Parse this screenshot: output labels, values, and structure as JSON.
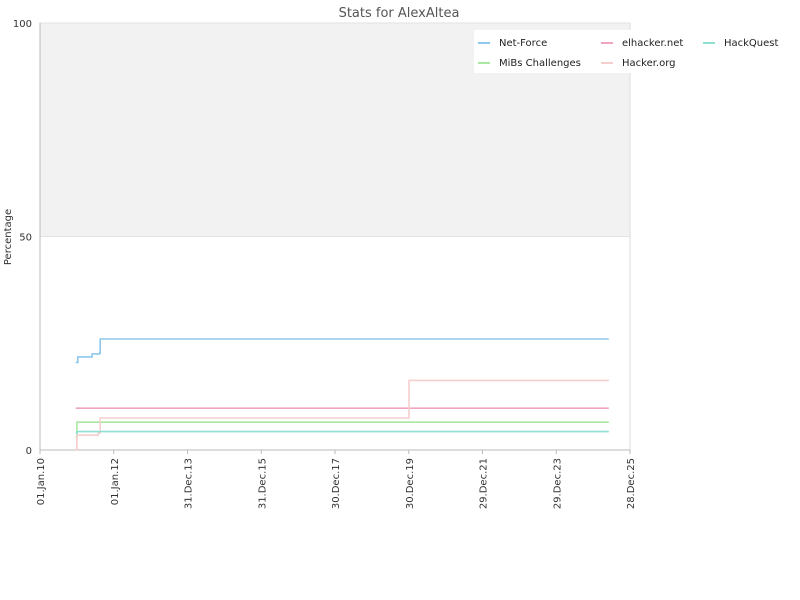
{
  "chart_data": {
    "type": "line",
    "title": "Stats for AlexAltea",
    "ylabel": "Percentage",
    "xlabel": "",
    "ylim": [
      0,
      100
    ],
    "y_ticks": [
      0,
      50,
      100
    ],
    "xlim": [
      "2010-01-01",
      "2025-12-28"
    ],
    "x_ticks": [
      "01.Jan.10",
      "01.Jan.12",
      "31.Dec.13",
      "31.Dec.15",
      "30.Dec.17",
      "30.Dec.19",
      "29.Dec.21",
      "29.Dec.23",
      "28.Dec.25"
    ],
    "bands": [
      {
        "from": 50,
        "to": 100,
        "color": "#f2f2f2"
      }
    ],
    "legend_position": "top-right",
    "series": [
      {
        "name": "Net-Force",
        "color": "#8ec9ec",
        "points": [
          [
            "2010-12-20",
            20.5
          ],
          [
            "2011-01-10",
            21.8
          ],
          [
            "2011-06-01",
            22.5
          ],
          [
            "2011-08-15",
            22.8
          ],
          [
            "2011-08-20",
            26
          ],
          [
            "2025-06-01",
            26
          ]
        ]
      },
      {
        "name": "MiBs Challenges",
        "color": "#a8e8a0",
        "points": [
          [
            "2010-12-20",
            3
          ],
          [
            "2011-01-01",
            6.5
          ],
          [
            "2025-06-01",
            6.5
          ]
        ]
      },
      {
        "name": "elhacker.net",
        "color": "#f2a3c4",
        "points": [
          [
            "2010-12-20",
            9.8
          ],
          [
            "2025-06-01",
            9.8
          ]
        ]
      },
      {
        "name": "Hacker.org",
        "color": "#f5cece",
        "points": [
          [
            "2010-12-20",
            0
          ],
          [
            "2011-01-01",
            3.5
          ],
          [
            "2011-08-01",
            4
          ],
          [
            "2011-08-20",
            7.5
          ],
          [
            "2020-01-01",
            16.3
          ],
          [
            "2025-06-01",
            16.3
          ]
        ]
      },
      {
        "name": "HackQuest",
        "color": "#8ee0d2",
        "points": [
          [
            "2010-12-20",
            4
          ],
          [
            "2011-01-01",
            4.3
          ],
          [
            "2025-06-01",
            4.3
          ]
        ]
      }
    ]
  }
}
